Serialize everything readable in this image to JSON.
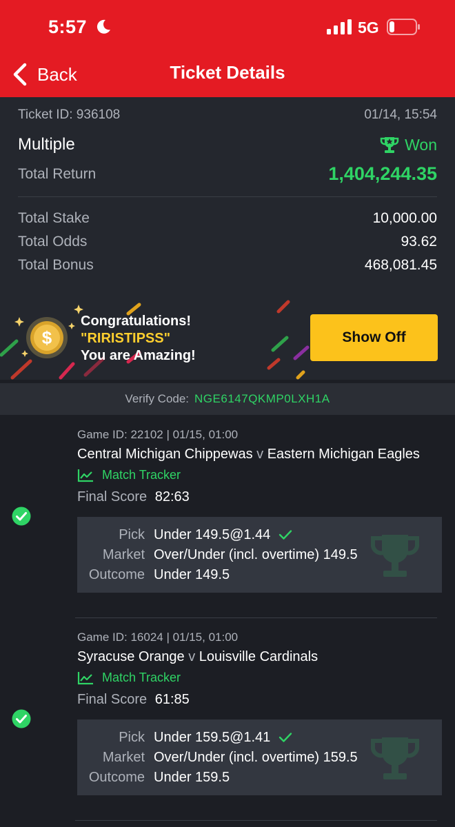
{
  "status_bar": {
    "time": "5:57",
    "network": "5G"
  },
  "nav": {
    "back_label": "Back",
    "title": "Ticket Details"
  },
  "ticket": {
    "id_label": "Ticket ID: 936108",
    "datetime": "01/14, 15:54",
    "bet_type": "Multiple",
    "status": "Won",
    "total_return_label": "Total Return",
    "total_return": "1,404,244.35",
    "rows": [
      {
        "label": "Total Stake",
        "value": "10,000.00"
      },
      {
        "label": "Total Odds",
        "value": "93.62"
      },
      {
        "label": "Total Bonus",
        "value": "468,081.45"
      }
    ]
  },
  "promo": {
    "line1": "Congratulations!",
    "line2": "\"RIRISTIPSS\"",
    "line3": "You are Amazing!",
    "button": "Show Off"
  },
  "verify": {
    "label": "Verify Code:",
    "code": "NGE6147QKMP0LXH1A"
  },
  "selections": [
    {
      "meta": "Game ID: 22102 | 01/15, 01:00",
      "home": "Central Michigan Chippewas",
      "vs": "v",
      "away": "Eastern Michigan Eagles",
      "tracker": "Match Tracker",
      "score_label": "Final Score",
      "score": "82:63",
      "pick_label": "Pick",
      "pick": "Under 149.5@1.44",
      "market_label": "Market",
      "market": "Over/Under (incl. overtime) 149.5",
      "outcome_label": "Outcome",
      "outcome": "Under 149.5"
    },
    {
      "meta": "Game ID: 16024 | 01/15, 01:00",
      "home": "Syracuse Orange",
      "vs": "v",
      "away": "Louisville Cardinals",
      "tracker": "Match Tracker",
      "score_label": "Final Score",
      "score": "61:85",
      "pick_label": "Pick",
      "pick": "Under 159.5@1.41",
      "market_label": "Market",
      "market": "Over/Under (incl. overtime) 159.5",
      "outcome_label": "Outcome",
      "outcome": "Under 159.5"
    }
  ],
  "colors": {
    "header_red": "#e41b23",
    "win_green": "#2fd465",
    "button_yellow": "#fcc21b",
    "background": "#1c1e24"
  }
}
